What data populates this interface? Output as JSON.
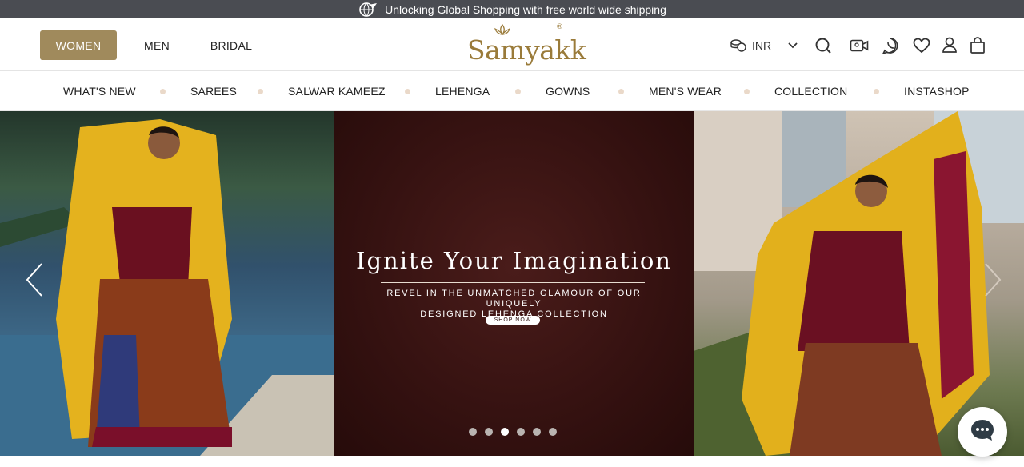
{
  "announcement": {
    "text": "Unlocking Global Shopping with free world wide shipping",
    "icon": "plane-globe-icon"
  },
  "header": {
    "gender_tabs": [
      {
        "label": "WOMEN",
        "active": true
      },
      {
        "label": "MEN",
        "active": false
      },
      {
        "label": "BRIDAL",
        "active": false
      }
    ],
    "logo": {
      "text": "Samyakk",
      "mark": "®"
    },
    "currency": {
      "label": "INR",
      "icon": "currency-icon"
    },
    "icons": [
      "chevron-down-icon",
      "search-icon",
      "video-call-icon",
      "whatsapp-icon",
      "wishlist-heart-icon",
      "account-icon",
      "cart-bag-icon"
    ]
  },
  "categories": [
    "WHAT'S NEW",
    "SAREES",
    "SALWAR KAMEEZ",
    "LEHENGA",
    "GOWNS",
    "MEN'S WEAR",
    "COLLECTION",
    "INSTASHOP"
  ],
  "hero": {
    "title": "Ignite Your Imagination",
    "subtitle_line1": "REVEL IN THE UNMATCHED GLAMOUR OF OUR UNIQUELY",
    "subtitle_line2": "DESIGNED LEHENGA COLLECTION",
    "cta": "SHOP NOW",
    "slide_count": 6,
    "active_slide": 3
  },
  "colors": {
    "accent": "#a08a5c",
    "topbar": "#4a4c52",
    "logo": "#9a7b3a",
    "promo_bg": "#361211"
  }
}
